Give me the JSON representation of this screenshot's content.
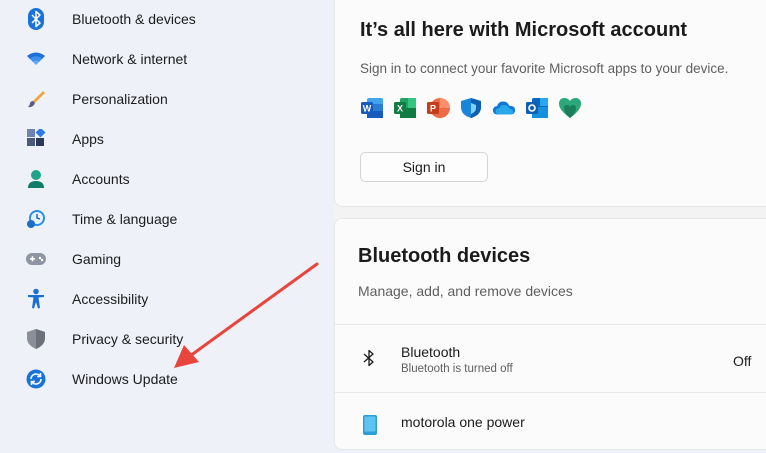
{
  "sidebar": {
    "items": [
      {
        "label": "Bluetooth & devices",
        "icon": "bluetooth-icon"
      },
      {
        "label": "Network & internet",
        "icon": "wifi-icon"
      },
      {
        "label": "Personalization",
        "icon": "brush-icon"
      },
      {
        "label": "Apps",
        "icon": "apps-icon"
      },
      {
        "label": "Accounts",
        "icon": "person-icon"
      },
      {
        "label": "Time & language",
        "icon": "clock-globe-icon"
      },
      {
        "label": "Gaming",
        "icon": "gamepad-icon"
      },
      {
        "label": "Accessibility",
        "icon": "accessibility-icon"
      },
      {
        "label": "Privacy & security",
        "icon": "shield-icon"
      },
      {
        "label": "Windows Update",
        "icon": "update-icon"
      }
    ]
  },
  "account_card": {
    "title": "It’s all here with Microsoft account",
    "subtitle": "Sign in to connect your favorite Microsoft apps to your device.",
    "apps": [
      "word-icon",
      "excel-icon",
      "powerpoint-icon",
      "defender-icon",
      "onedrive-icon",
      "outlook-icon",
      "family-icon"
    ],
    "sign_in_label": "Sign in"
  },
  "bluetooth_card": {
    "title": "Bluetooth devices",
    "subtitle": "Manage, add, and remove devices",
    "devices": [
      {
        "name": "Bluetooth",
        "status": "Bluetooth is turned off",
        "right": "Off",
        "icon": "bluetooth-icon"
      },
      {
        "name": "motorola one power",
        "icon": "phone-icon"
      }
    ]
  },
  "annotation": {
    "color": "#e8453c",
    "target": "Windows Update"
  },
  "colors": {
    "accent": "#0067c0",
    "sidebar_bg": "#eef2f8",
    "card_bg": "#fbfbfb"
  }
}
